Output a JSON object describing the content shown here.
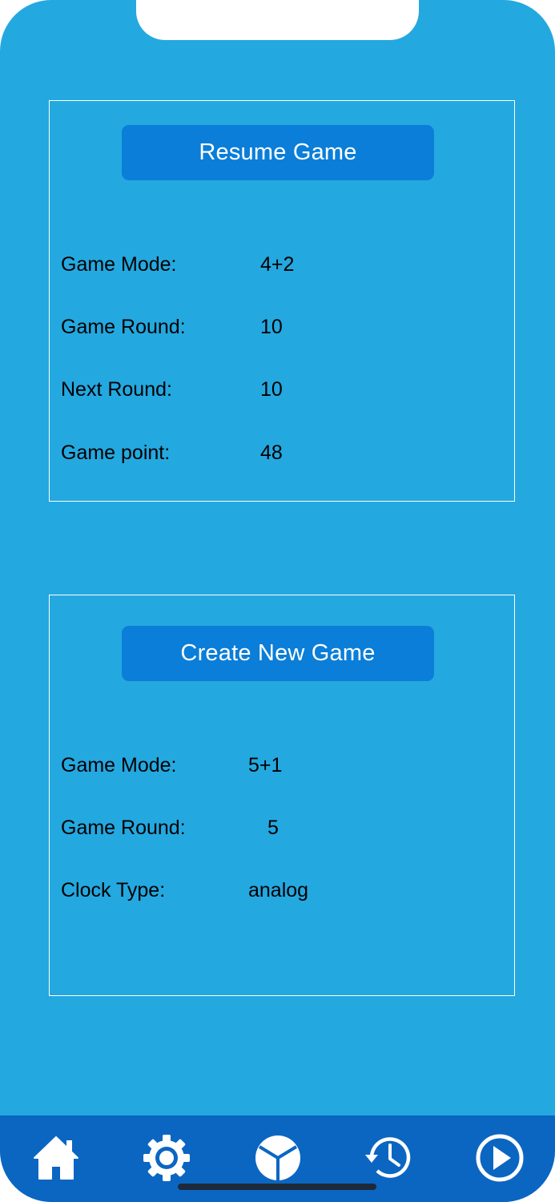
{
  "resume_panel": {
    "button_label": "Resume Game",
    "rows": [
      {
        "label": "Game Mode:",
        "value": "4+2"
      },
      {
        "label": "Game Round:",
        "value": "10"
      },
      {
        "label": "Next Round:",
        "value": "10"
      },
      {
        "label": "Game point:",
        "value": "48"
      }
    ]
  },
  "create_panel": {
    "button_label": "Create New Game",
    "rows": [
      {
        "label": "Game Mode:",
        "value": "5+1"
      },
      {
        "label": "Game Round:",
        "value": "5"
      },
      {
        "label": "Clock Type:",
        "value": "analog"
      }
    ]
  },
  "tab_bar": {
    "tabs": [
      {
        "icon": "home-icon"
      },
      {
        "icon": "gear-icon"
      },
      {
        "icon": "pie-icon"
      },
      {
        "icon": "history-icon"
      },
      {
        "icon": "play-icon"
      }
    ]
  },
  "colors": {
    "background": "#24a8e0",
    "button": "#0a7ed8",
    "tab_bar": "#0b66c2",
    "text": "#000000",
    "button_text": "#ffffff"
  }
}
